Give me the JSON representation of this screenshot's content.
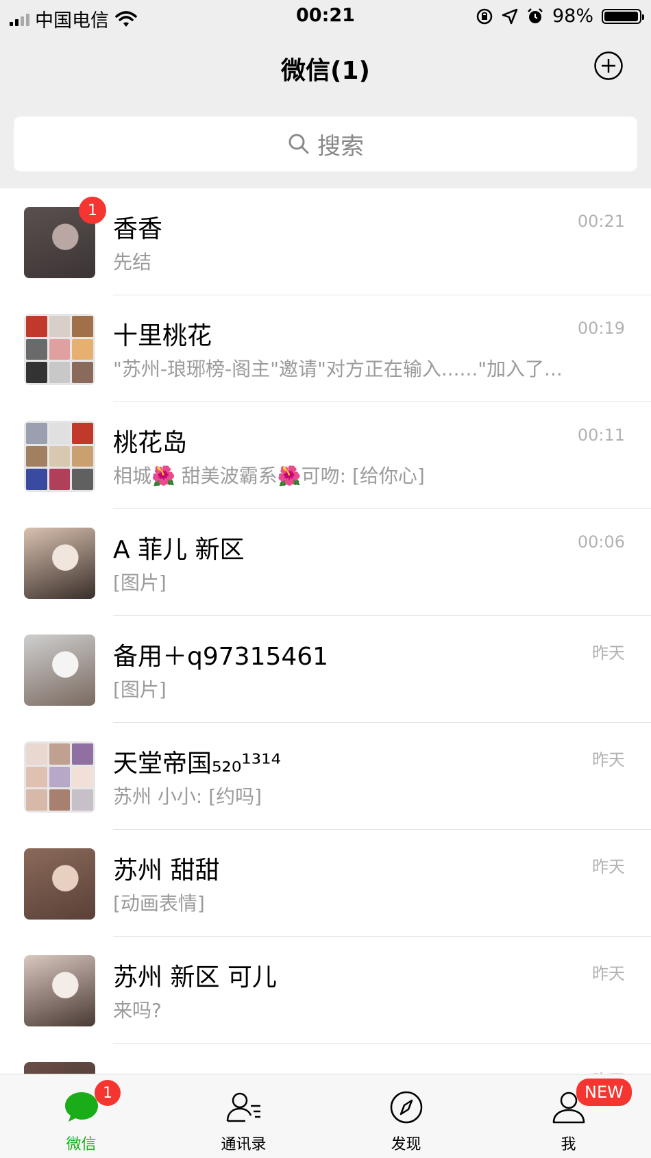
{
  "status_bar": {
    "carrier": "中国电信",
    "time": "00:21",
    "battery_text": "98%",
    "battery_level": 0.98,
    "icons": [
      "signal-icon",
      "wifi-icon",
      "orientation-lock-icon",
      "location-icon",
      "alarm-icon",
      "battery-icon"
    ]
  },
  "header": {
    "title": "微信(1)",
    "add_icon": "plus-circle-icon"
  },
  "search": {
    "placeholder": "搜索",
    "icon": "search-icon"
  },
  "chats": [
    {
      "name": "香香",
      "preview": "先结",
      "time": "00:21",
      "badge": "1",
      "avatar_colors": [
        "#5a5050",
        "#b8a7a2",
        "#3c3434"
      ]
    },
    {
      "name": "十里桃花",
      "preview": "\"苏州-琅琊榜-阁主\"邀请\"对方正在输入......\"加入了...",
      "time": "00:19",
      "avatar_colors": [
        "#c0392b",
        "#d8d0c8",
        "#a0704a",
        "#6a6a6a",
        "#e0a0a0",
        "#e8b070",
        "#333333",
        "#c8c8c8",
        "#8a6a5a"
      ]
    },
    {
      "name": "桃花岛",
      "preview": "相城🌺  甜美波霸系🌺可吻: [给你心]",
      "time": "00:11",
      "avatar_colors": [
        "#9aa0b0",
        "#e0e0e0",
        "#c0392b",
        "#a08060",
        "#d8c8b0",
        "#caa070",
        "#3a4aa0",
        "#b0405a",
        "#606060"
      ]
    },
    {
      "name": "A  菲儿  新区",
      "preview": "[图片]",
      "time": "00:06",
      "avatar_colors": [
        "#d9c1b0",
        "#f1e6dd",
        "#3a2f2a"
      ]
    },
    {
      "name": "备用＋q97315461",
      "preview": "[图片]",
      "time": "昨天",
      "avatar_colors": [
        "#cfcfcf",
        "#f4f4f4",
        "#7a6a60"
      ]
    },
    {
      "name": "天堂帝国₅₂₀¹³¹⁴",
      "preview": "苏州    小小: [约吗]",
      "time": "昨天",
      "avatar_colors": [
        "#e8d8d0",
        "#c0a090",
        "#9070a0",
        "#e0c0b0",
        "#b8a8c8",
        "#f0e0d8",
        "#d8b8a8",
        "#a88070",
        "#c8c0c8"
      ]
    },
    {
      "name": "苏州    甜甜",
      "preview": "[动画表情]",
      "time": "昨天",
      "avatar_colors": [
        "#8a6a5a",
        "#e8d0c0",
        "#5a4038"
      ]
    },
    {
      "name": "苏州   新区   可儿",
      "preview": "来吗?",
      "time": "昨天",
      "avatar_colors": [
        "#d8c8c0",
        "#f4ece6",
        "#4a3a34"
      ]
    },
    {
      "name": "",
      "preview": "",
      "time": "昨天",
      "avatar_colors": [
        "#6a5048",
        "#d0b8a8",
        "#3a2a24"
      ]
    }
  ],
  "tabs": [
    {
      "label": "微信",
      "icon": "chat-bubble-icon",
      "badge": "1",
      "active": true
    },
    {
      "label": "通讯录",
      "icon": "contacts-icon"
    },
    {
      "label": "发现",
      "icon": "compass-icon"
    },
    {
      "label": "我",
      "icon": "person-icon",
      "badge": "NEW"
    }
  ],
  "colors": {
    "accent_green": "#1aad19",
    "badge_red": "#f43530",
    "header_bg": "#eeeeef"
  }
}
